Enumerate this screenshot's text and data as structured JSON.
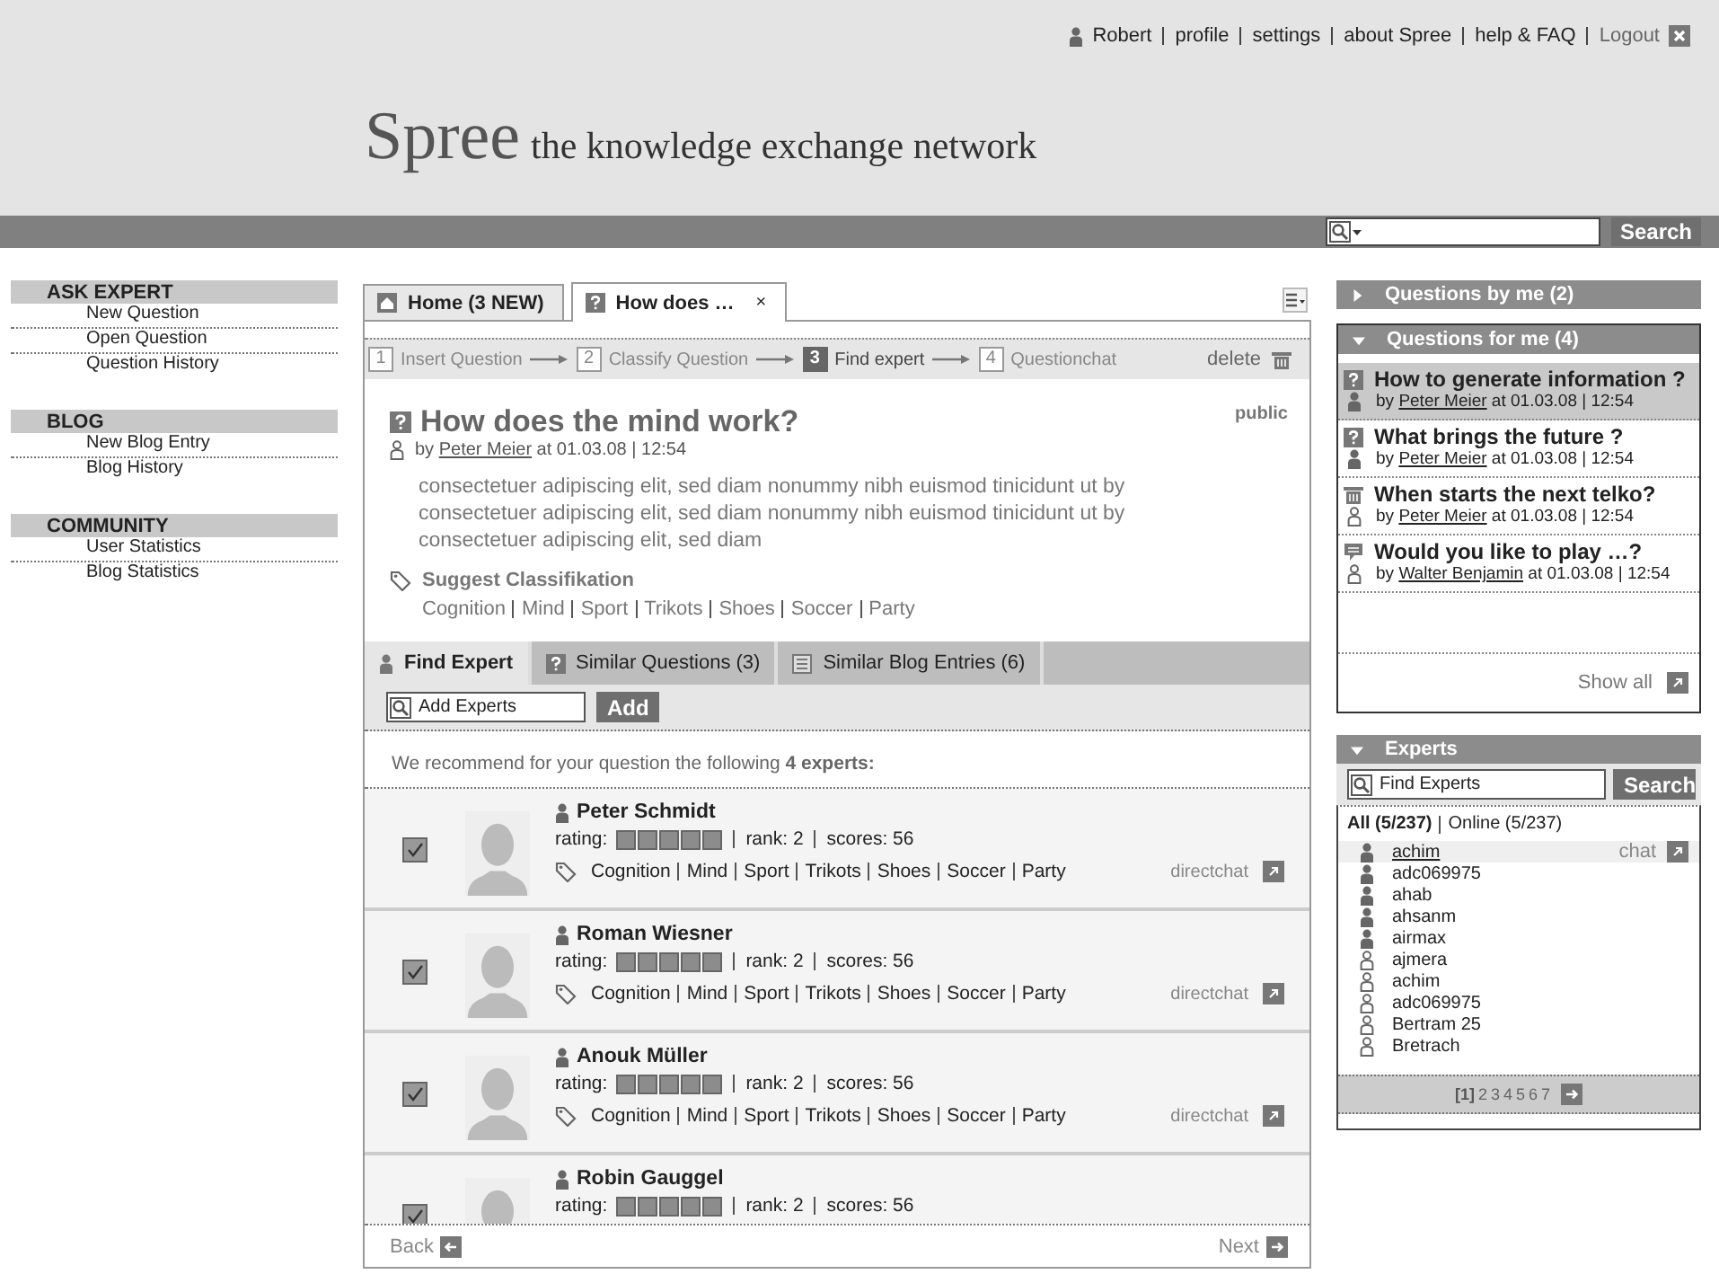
{
  "header": {
    "user": "Robert",
    "links": [
      "profile",
      "settings",
      "about Spree",
      "help & FAQ"
    ],
    "logout": "Logout",
    "logo": "Spree",
    "tagline": "the knowledge exchange network",
    "search_button": "Search"
  },
  "sidebar": [
    {
      "title": "ASK EXPERT",
      "items": [
        "New Question",
        "Open Question",
        "Question History"
      ]
    },
    {
      "title": "BLOG",
      "items": [
        "New Blog Entry",
        "Blog History"
      ]
    },
    {
      "title": "COMMUNITY",
      "items": [
        "User Statistics",
        "Blog Statistics"
      ]
    }
  ],
  "tabs": [
    {
      "label": "Home (3 NEW)",
      "kind": "home",
      "selected": false
    },
    {
      "label": "How does …",
      "kind": "question",
      "selected": true,
      "close": "×"
    }
  ],
  "steps": [
    {
      "number": "1",
      "label": "Insert Question",
      "selected": false
    },
    {
      "number": "2",
      "label": "Classify Question",
      "selected": false
    },
    {
      "number": "3",
      "label": "Find expert",
      "selected": true
    },
    {
      "number": "4",
      "label": "Questionchat",
      "selected": false
    }
  ],
  "delete": "delete",
  "question": {
    "title": "How does the mind work?",
    "visibility": "public",
    "by": "by",
    "author": "Peter Meier",
    "meta": "at 01.03.08 | 12:54",
    "body": "consectetuer adipiscing elit, sed diam nonummy nibh euismod tinicidunt ut by  consectetuer adipiscing elit, sed diam nonummy nibh euismod tinicidunt ut by  consectetuer adipiscing elit, sed diam",
    "suggest_title": "Suggest Classifikation",
    "tags": [
      "Cognition",
      "Mind",
      "Sport",
      "Trikots",
      "Shoes",
      "Soccer",
      "Party"
    ]
  },
  "subtabs": [
    {
      "label": "Find Expert",
      "kind": "person",
      "selected": true
    },
    {
      "label": "Similar Questions (3)",
      "kind": "question",
      "selected": false
    },
    {
      "label": "Similar Blog Entries (6)",
      "kind": "blog",
      "selected": false
    }
  ],
  "add_experts": {
    "placeholder": "Add Experts",
    "button": "Add"
  },
  "recommend": "We recommend for your question the following **4 experts:**",
  "experts": [
    {
      "name": "Peter Schmidt",
      "checked": true,
      "rating_label": "rating:",
      "stars": 5,
      "rank": "rank: 2",
      "scores": "scores: 56",
      "tags": [
        "Cognition",
        "Mind",
        "Sport",
        "Trikots",
        "Shoes",
        "Soccer",
        "Party"
      ],
      "directchat": "directchat"
    },
    {
      "name": "Roman Wiesner",
      "checked": true,
      "rating_label": "rating:",
      "stars": 5,
      "rank": "rank: 2",
      "scores": "scores: 56",
      "tags": [
        "Cognition",
        "Mind",
        "Sport",
        "Trikots",
        "Shoes",
        "Soccer",
        "Party"
      ],
      "directchat": "directchat"
    },
    {
      "name": "Anouk Müller",
      "checked": true,
      "rating_label": "rating:",
      "stars": 5,
      "rank": "rank: 2",
      "scores": "scores: 56",
      "tags": [
        "Cognition",
        "Mind",
        "Sport",
        "Trikots",
        "Shoes",
        "Soccer",
        "Party"
      ],
      "directchat": "directchat"
    },
    {
      "name": "Robin Gauggel",
      "checked": true,
      "rating_label": "rating:",
      "stars": 5,
      "rank": "rank: 2",
      "scores": "scores: 56"
    }
  ],
  "pager": {
    "back": "Back",
    "next": "Next"
  },
  "questions_by_me": {
    "title": "Questions by me (2)",
    "expanded": false
  },
  "questions_for_me": {
    "title": "Questions for me (4)",
    "expanded": true,
    "show_all": "Show all",
    "items": [
      {
        "kind": "question",
        "title": "How to generate information ?",
        "by": "by",
        "author": "Peter Meier",
        "meta": "at 01.03.08 | 12:54",
        "online": true,
        "selected": true
      },
      {
        "kind": "question",
        "title": "What brings the future ?",
        "by": "by",
        "author": "Peter Meier",
        "meta": "at 01.03.08 | 12:54",
        "online": true,
        "selected": false
      },
      {
        "kind": "trash",
        "title": "When starts the next telko?",
        "by": "by",
        "author": "Peter Meier",
        "meta": "at 01.03.08 | 12:54",
        "online": false,
        "selected": false
      },
      {
        "kind": "chat",
        "title": "Would you like to play …?",
        "by": "by",
        "author": "Walter Benjamin",
        "meta": "at 01.03.08 | 12:54",
        "online": false,
        "selected": false
      }
    ]
  },
  "experts_panel": {
    "title": "Experts",
    "expanded": true,
    "placeholder": "Find Experts",
    "button": "Search",
    "chat": "chat",
    "filters": [
      {
        "label": "All (5/237)",
        "selected": true
      },
      {
        "label": "Online (5/237)",
        "selected": false
      }
    ],
    "users": [
      {
        "name": "achim",
        "online": true,
        "selected": true
      },
      {
        "name": "adc069975",
        "online": true,
        "selected": false
      },
      {
        "name": "ahab",
        "online": true,
        "selected": false
      },
      {
        "name": "ahsanm",
        "online": true,
        "selected": false
      },
      {
        "name": "airmax",
        "online": true,
        "selected": false
      },
      {
        "name": "ajmera",
        "online": false,
        "selected": false
      },
      {
        "name": "achim",
        "online": false,
        "selected": false
      },
      {
        "name": "adc069975",
        "online": false,
        "selected": false
      },
      {
        "name": "Bertram 25",
        "online": false,
        "selected": false
      },
      {
        "name": "Bretrach",
        "online": false,
        "selected": false
      }
    ],
    "pages": [
      {
        "label": "[1]",
        "selected": true
      },
      {
        "label": "2",
        "selected": false
      },
      {
        "label": "3",
        "selected": false
      },
      {
        "label": "4",
        "selected": false
      },
      {
        "label": "5",
        "selected": false
      },
      {
        "label": "6",
        "selected": false
      },
      {
        "label": "7",
        "selected": false
      }
    ]
  }
}
